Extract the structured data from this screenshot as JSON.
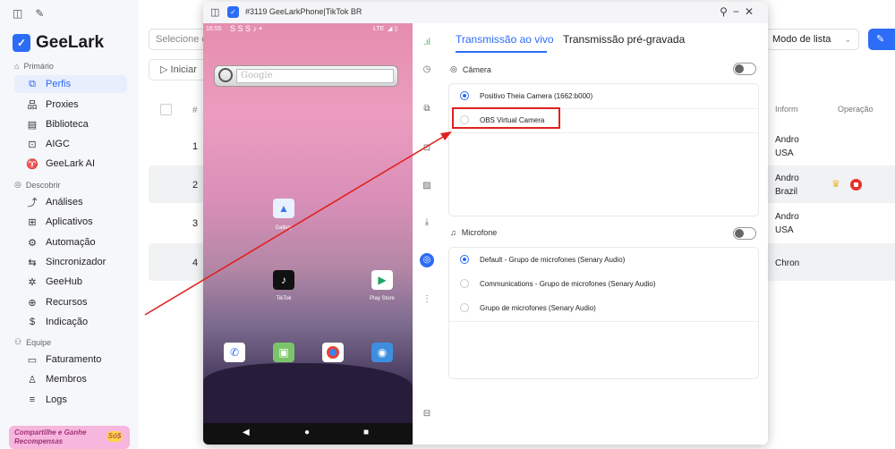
{
  "app": {
    "brand": "GeeLark"
  },
  "sidebar": {
    "sections": {
      "primary": "Primário",
      "discover": "Descobrir",
      "team": "Equipe"
    },
    "items": [
      {
        "label": "Perfis",
        "icon": "profiles-icon"
      },
      {
        "label": "Proxies",
        "icon": "proxies-icon"
      },
      {
        "label": "Biblioteca",
        "icon": "library-icon"
      },
      {
        "label": "AIGC",
        "icon": "aigc-icon"
      },
      {
        "label": "GeeLark AI",
        "icon": "ai-icon"
      },
      {
        "label": "Análises",
        "icon": "analytics-icon"
      },
      {
        "label": "Aplicativos",
        "icon": "apps-icon"
      },
      {
        "label": "Automação",
        "icon": "automation-icon"
      },
      {
        "label": "Sincronizador",
        "icon": "sync-icon"
      },
      {
        "label": "GeeHub",
        "icon": "geehub-icon"
      },
      {
        "label": "Recursos",
        "icon": "resources-icon"
      },
      {
        "label": "Indicação",
        "icon": "referral-icon"
      },
      {
        "label": "Faturamento",
        "icon": "billing-icon"
      },
      {
        "label": "Membros",
        "icon": "members-icon"
      },
      {
        "label": "Logs",
        "icon": "logs-icon"
      }
    ],
    "promo": "Compartilhe e Ganhe Recompensas",
    "promo_badge": "Só$"
  },
  "main": {
    "search_placeholder": "Selecione ou",
    "start_label": "Iniciar",
    "table_hash": "#",
    "rows": [
      "1",
      "2",
      "3",
      "4"
    ],
    "list_mode": "Modo de lista",
    "col_info": "Inform",
    "col_operation": "Operação",
    "info_cells": [
      {
        "line1": "Andro",
        "line2": "USA"
      },
      {
        "line1": "Andro",
        "line2": "Brazil"
      },
      {
        "line1": "Andro",
        "line2": "USA"
      },
      {
        "line1": "Chron",
        "line2": ""
      }
    ]
  },
  "window": {
    "title": "#3119 GeeLarkPhone|TikTok BR",
    "phone": {
      "time": "16:55",
      "status_icons": "S S S ♪ •",
      "network": "LTE",
      "search_placeholder": "Google",
      "apps": {
        "gallery": "Gallery",
        "tiktok": "TikTok",
        "playstore": "Play Store"
      }
    },
    "tabs": {
      "live": "Transmissão ao vivo",
      "prerecorded": "Transmissão pré-gravada"
    },
    "camera": {
      "label": "Câmera",
      "options": [
        "Positivo Theia Camera (1662:b000)",
        "OBS Virtual Camera"
      ],
      "selected": 0
    },
    "microphone": {
      "label": "Microfone",
      "options": [
        "Default - Grupo de microfones (Senary Audio)",
        "Communications - Grupo de microfones (Senary Audio)",
        "Grupo de microfones (Senary Audio)"
      ],
      "selected": 0
    }
  },
  "colors": {
    "accent": "#2c6cf6",
    "highlight": "#e0211f"
  }
}
